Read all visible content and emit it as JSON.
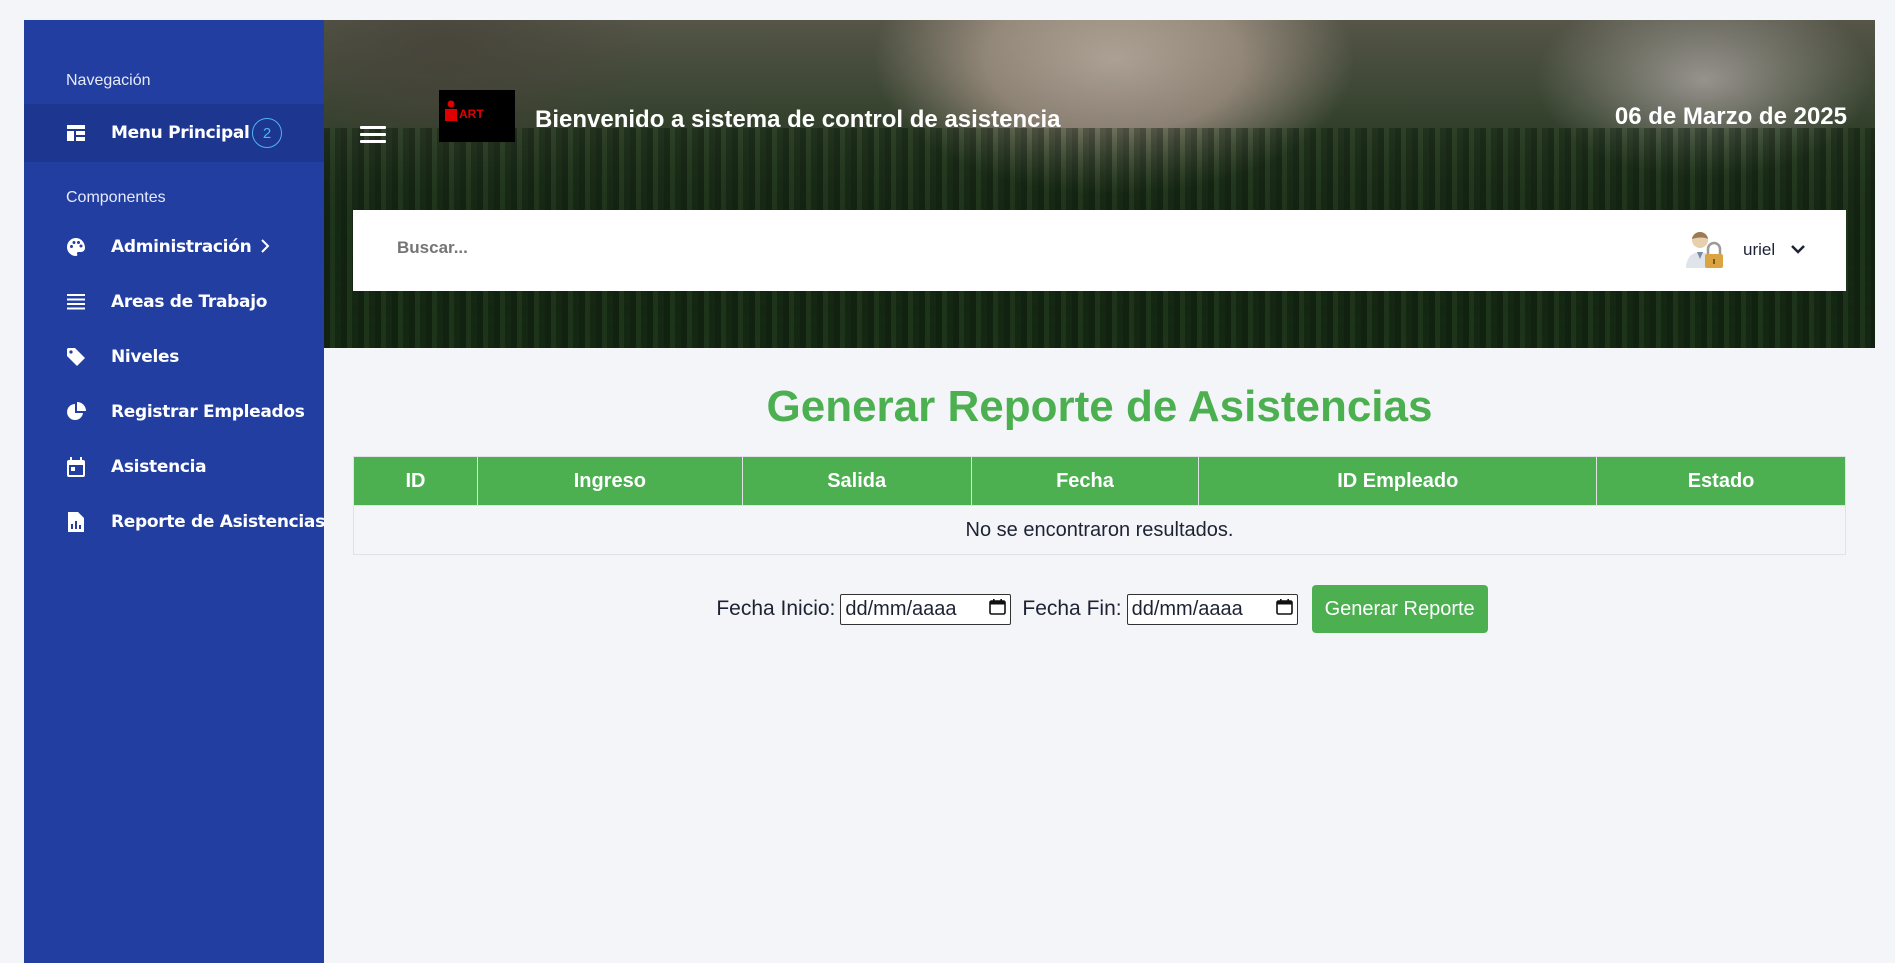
{
  "sidebar": {
    "sections": [
      "Navegación",
      "Componentes"
    ],
    "menu_principal": {
      "label": "Menu Principal",
      "badge": "2",
      "icon": "dashboard-icon"
    },
    "items": [
      {
        "label": "Administración",
        "icon": "palette-icon"
      },
      {
        "label": "Areas de Trabajo",
        "icon": "list-icon"
      },
      {
        "label": "Niveles",
        "icon": "tag-icon"
      },
      {
        "label": "Registrar Empleados",
        "icon": "pie-chart-icon"
      },
      {
        "label": "Asistencia",
        "icon": "calendar-icon"
      },
      {
        "label": "Reporte de Asistencias",
        "icon": "report-icon"
      }
    ]
  },
  "header": {
    "logo_text": "ART",
    "title": "Bienvenido a sistema de control de asistencia",
    "date": "06 de Marzo de 2025",
    "search_placeholder": "Buscar...",
    "user": "uriel"
  },
  "main": {
    "title": "Generar Reporte de Asistencias",
    "columns": [
      "ID",
      "Ingreso",
      "Salida",
      "Fecha",
      "ID Empleado",
      "Estado"
    ],
    "empty_message": "No se encontraron resultados.",
    "fecha_inicio_label": "Fecha Inicio:",
    "fecha_fin_label": "Fecha Fin:",
    "date_placeholder": "dd/mm/aaaa",
    "button": "Generar Reporte"
  },
  "colors": {
    "sidebar": "#223ea0",
    "accent": "#4caf50",
    "badge": "#4fb3f5"
  }
}
